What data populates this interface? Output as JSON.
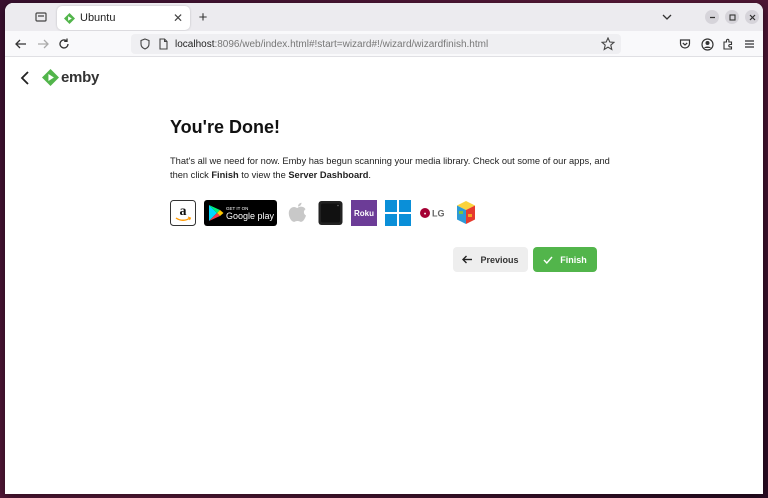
{
  "browser": {
    "tab_title": "Ubuntu",
    "url_host": "localhost",
    "url_rest": ":8096/web/index.html#!start=wizard#!/wizard/wizardfinish.html"
  },
  "app": {
    "logo_text": "emby",
    "brand_color": "#52b54b"
  },
  "page": {
    "heading": "You're Done!",
    "desc_part1": "That's all we need for now. Emby has begun scanning your media library. Check out some of our apps, and then click ",
    "desc_finish": "Finish",
    "desc_part2": " to view the ",
    "desc_dashboard": "Server Dashboard",
    "desc_part3": "."
  },
  "apps": {
    "googleplay_top": "GET IT ON",
    "googleplay_main": "Google play",
    "roku": "Roku",
    "lg": "LG"
  },
  "buttons": {
    "previous": "Previous",
    "finish": "Finish"
  }
}
